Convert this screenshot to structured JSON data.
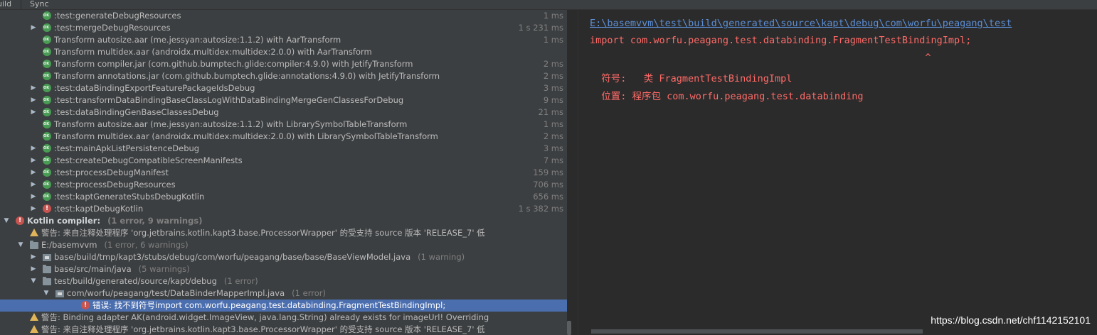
{
  "tabs": [
    "uild",
    "Sync"
  ],
  "tree_rows": [
    {
      "indent": 60,
      "arrow": "",
      "icon": "ok",
      "text": ":test:generateDebugResources",
      "hint": "",
      "time": "1 ms",
      "bold": false
    },
    {
      "indent": 60,
      "arrow": "▶",
      "icon": "ok",
      "text": ":test:mergeDebugResources",
      "hint": "",
      "time": "1 s 231 ms",
      "bold": false
    },
    {
      "indent": 60,
      "arrow": "",
      "icon": "ok",
      "text": "Transform autosize.aar (me.jessyan:autosize:1.1.2) with AarTransform",
      "hint": "",
      "time": "1 ms",
      "bold": false
    },
    {
      "indent": 60,
      "arrow": "",
      "icon": "ok",
      "text": "Transform multidex.aar (androidx.multidex:multidex:2.0.0) with AarTransform",
      "hint": "",
      "time": "",
      "bold": false
    },
    {
      "indent": 60,
      "arrow": "",
      "icon": "ok",
      "text": "Transform compiler.jar (com.github.bumptech.glide:compiler:4.9.0) with JetifyTransform",
      "hint": "",
      "time": "2 ms",
      "bold": false
    },
    {
      "indent": 60,
      "arrow": "",
      "icon": "ok",
      "text": "Transform annotations.jar (com.github.bumptech.glide:annotations:4.9.0) with JetifyTransform",
      "hint": "",
      "time": "2 ms",
      "bold": false
    },
    {
      "indent": 60,
      "arrow": "▶",
      "icon": "ok",
      "text": ":test:dataBindingExportFeaturePackageIdsDebug",
      "hint": "",
      "time": "3 ms",
      "bold": false
    },
    {
      "indent": 60,
      "arrow": "▶",
      "icon": "ok",
      "text": ":test:transformDataBindingBaseClassLogWithDataBindingMergeGenClassesForDebug",
      "hint": "",
      "time": "9 ms",
      "bold": false
    },
    {
      "indent": 60,
      "arrow": "▶",
      "icon": "ok",
      "text": ":test:dataBindingGenBaseClassesDebug",
      "hint": "",
      "time": "21 ms",
      "bold": false
    },
    {
      "indent": 60,
      "arrow": "",
      "icon": "ok",
      "text": "Transform autosize.aar (me.jessyan:autosize:1.1.2) with LibrarySymbolTableTransform",
      "hint": "",
      "time": "1 ms",
      "bold": false
    },
    {
      "indent": 60,
      "arrow": "",
      "icon": "ok",
      "text": "Transform multidex.aar (androidx.multidex:multidex:2.0.0) with LibrarySymbolTableTransform",
      "hint": "",
      "time": "2 ms",
      "bold": false
    },
    {
      "indent": 60,
      "arrow": "▶",
      "icon": "ok",
      "text": ":test:mainApkListPersistenceDebug",
      "hint": "",
      "time": "3 ms",
      "bold": false
    },
    {
      "indent": 60,
      "arrow": "▶",
      "icon": "ok",
      "text": ":test:createDebugCompatibleScreenManifests",
      "hint": "",
      "time": "7 ms",
      "bold": false
    },
    {
      "indent": 60,
      "arrow": "▶",
      "icon": "ok",
      "text": ":test:processDebugManifest",
      "hint": "",
      "time": "159 ms",
      "bold": false
    },
    {
      "indent": 60,
      "arrow": "▶",
      "icon": "ok",
      "text": ":test:processDebugResources",
      "hint": "",
      "time": "706 ms",
      "bold": false
    },
    {
      "indent": 60,
      "arrow": "▶",
      "icon": "ok",
      "text": ":test:kaptGenerateStubsDebugKotlin",
      "hint": "",
      "time": "656 ms",
      "bold": false
    },
    {
      "indent": 60,
      "arrow": "▶",
      "icon": "err",
      "text": ":test:kaptDebugKotlin",
      "hint": "",
      "time": "1 s 382 ms",
      "bold": false
    },
    {
      "indent": 22,
      "arrow": "▼",
      "icon": "err",
      "text": "Kotlin compiler:",
      "hint": "(1 error, 9 warnings)",
      "time": "",
      "bold": true
    },
    {
      "indent": 42,
      "arrow": "",
      "icon": "warn",
      "text": "警告: 来自注释处理程序 'org.jetbrains.kotlin.kapt3.base.ProcessorWrapper' 的受支持 source 版本 'RELEASE_7' 低",
      "hint": "",
      "time": "",
      "bold": false
    },
    {
      "indent": 42,
      "arrow": "▼",
      "icon": "folder",
      "text": "E:/basemvvm",
      "hint": "(1 error, 6 warnings)",
      "time": "",
      "bold": false
    },
    {
      "indent": 60,
      "arrow": "▶",
      "icon": "pkg",
      "text": "base/build/tmp/kapt3/stubs/debug/com/worfu/peagang/base/base/BaseViewModel.java",
      "hint": "(1 warning)",
      "time": "",
      "bold": false
    },
    {
      "indent": 60,
      "arrow": "▶",
      "icon": "folder",
      "text": "base/src/main/java",
      "hint": "(5 warnings)",
      "time": "",
      "bold": false
    },
    {
      "indent": 60,
      "arrow": "▼",
      "icon": "folder",
      "text": "test/build/generated/source/kapt/debug",
      "hint": "(1 error)",
      "time": "",
      "bold": false
    },
    {
      "indent": 78,
      "arrow": "▼",
      "icon": "pkg",
      "text": "com/worfu/peagang/test/DataBinderMapperImpl.java",
      "hint": "(1 error)",
      "time": "",
      "bold": false
    },
    {
      "indent": 114,
      "arrow": "",
      "icon": "err",
      "text": "错误: 找不到符号import com.worfu.peagang.test.databinding.FragmentTestBindingImpl;",
      "hint": "",
      "time": "",
      "bold": false,
      "selected": true
    },
    {
      "indent": 42,
      "arrow": "",
      "icon": "warn",
      "text": "警告: Binding adapter AK(android.widget.ImageView, java.lang.String) already exists for imageUrl! Overriding",
      "hint": "",
      "time": "",
      "bold": false
    },
    {
      "indent": 42,
      "arrow": "",
      "icon": "warn",
      "text": "警告: 来自注释处理程序 'org.jetbrains.kotlin.kapt3.base.ProcessorWrapper' 的受支持 source 版本 'RELEASE_7' 低",
      "hint": "",
      "time": "",
      "bold": false
    }
  ],
  "console": {
    "path_link": "E:\\basemvvm\\test\\build\\generated\\source\\kapt\\debug\\com\\worfu\\peagang\\test",
    "import_line": "import com.worfu.peagang.test.databinding.FragmentTestBindingImpl;",
    "caret_line": "                                                          ^",
    "symbol_line": "  符号:   类 FragmentTestBindingImpl",
    "location_line": "  位置: 程序包 com.worfu.peagang.test.databinding"
  },
  "watermark": "https://blog.csdn.net/chf1142152101",
  "colors": {
    "ok": "#499c54",
    "error": "#c75450",
    "warning": "#e0b45a",
    "selection": "#4b6eaf",
    "console_error": "#ff6b68",
    "link": "#5c8fd6"
  }
}
